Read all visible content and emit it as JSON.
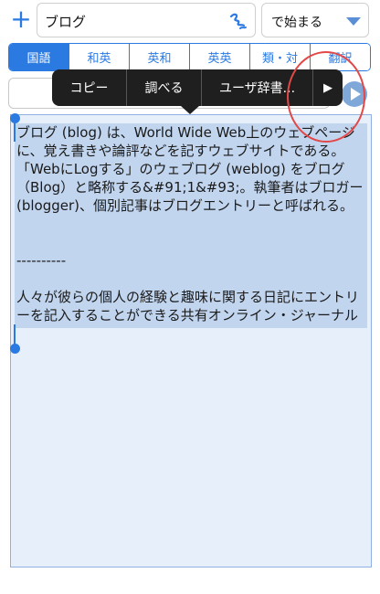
{
  "toolbar": {
    "add_symbol": "+",
    "search_value": "ブログ",
    "handwriting_icon": "handwriting-icon",
    "mode_value": "で始まる"
  },
  "tabs": [
    {
      "label": "国語",
      "active": true
    },
    {
      "label": "和英",
      "active": false
    },
    {
      "label": "英和",
      "active": false
    },
    {
      "label": "英英",
      "active": false
    },
    {
      "label": "類・対",
      "active": false
    },
    {
      "label": "翻訳",
      "active": false
    }
  ],
  "popup": {
    "copy": "コピー",
    "lookup": "調べる",
    "user_dict": "ユーザ辞書...",
    "more": "▶"
  },
  "content": {
    "para1": "ブログ (blog) は、World Wide Web上のウェブページに、覚え書きや論評などを記すウェブサイトである。「WebにLogする」のウェブログ (weblog) をブログ（Blog）と略称する&#91;1&#93;。執筆者はブロガー (blogger)、個別記事はブログエントリーと呼ばれる。",
    "divider": "----------",
    "para2": "人々が彼らの個人の経験と趣味に関する日記にエントリーを記入することができる共有オンライン・ジャーナル"
  },
  "colors": {
    "accent": "#2a7ae2",
    "selection": "#c2d5ef",
    "area_bg": "#e7effb",
    "popup_bg": "#1f1f1f",
    "annotation": "#e24848"
  }
}
